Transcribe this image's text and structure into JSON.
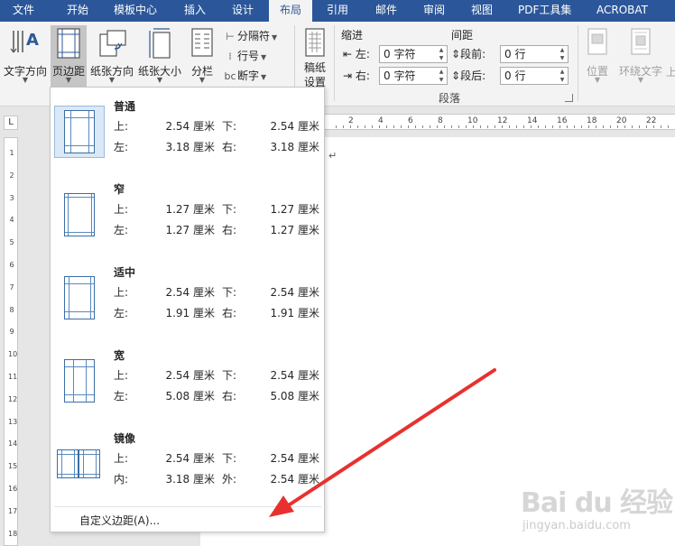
{
  "ribbon_tabs": [
    {
      "label": "文件"
    },
    {
      "label": "开始"
    },
    {
      "label": "模板中心"
    },
    {
      "label": "插入"
    },
    {
      "label": "设计"
    },
    {
      "label": "布局"
    },
    {
      "label": "引用"
    },
    {
      "label": "邮件"
    },
    {
      "label": "审阅"
    },
    {
      "label": "视图"
    },
    {
      "label": "PDF工具集"
    },
    {
      "label": "ACROBAT"
    }
  ],
  "page_setup": {
    "text_direction": "文字方向",
    "margins": "页边距",
    "orientation": "纸张方向",
    "size": "纸张大小",
    "columns": "分栏",
    "breaks": "分隔符",
    "line_numbers": "行号",
    "hyphenation": "断字"
  },
  "manuscript": {
    "label_line1": "稿纸",
    "label_line2": "设置"
  },
  "paragraph": {
    "indent_title": "缩进",
    "spacing_title": "间距",
    "left_label": "左:",
    "left_value": "0 字符",
    "right_label": "右:",
    "right_value": "0 字符",
    "before_label": "段前:",
    "before_value": "0 行",
    "after_label": "段后:",
    "after_value": "0 行",
    "group_label": "段落"
  },
  "arrange": {
    "position": "位置",
    "wrap_text": "环绕文字",
    "bring_forward": "上"
  },
  "rulers": {
    "corner": "L",
    "h_ticks": [
      "2",
      "4",
      "6",
      "8",
      "10",
      "12",
      "14",
      "16",
      "18",
      "20",
      "22"
    ],
    "v_ticks": [
      "1",
      "2",
      "3",
      "4",
      "5",
      "6",
      "7",
      "8",
      "9",
      "10",
      "11",
      "12",
      "13",
      "14",
      "15",
      "16",
      "17",
      "18"
    ]
  },
  "document": {
    "paragraph_mark": "↵"
  },
  "margins_menu": {
    "presets": [
      {
        "name": "普通",
        "label1": "上:",
        "value1": "2.54 厘米",
        "label2": "下:",
        "value2": "2.54 厘米",
        "label3": "左:",
        "value3": "3.18 厘米",
        "label4": "右:",
        "value4": "3.18 厘米"
      },
      {
        "name": "窄",
        "label1": "上:",
        "value1": "1.27 厘米",
        "label2": "下:",
        "value2": "1.27 厘米",
        "label3": "左:",
        "value3": "1.27 厘米",
        "label4": "右:",
        "value4": "1.27 厘米"
      },
      {
        "name": "适中",
        "label1": "上:",
        "value1": "2.54 厘米",
        "label2": "下:",
        "value2": "2.54 厘米",
        "label3": "左:",
        "value3": "1.91 厘米",
        "label4": "右:",
        "value4": "1.91 厘米"
      },
      {
        "name": "宽",
        "label1": "上:",
        "value1": "2.54 厘米",
        "label2": "下:",
        "value2": "2.54 厘米",
        "label3": "左:",
        "value3": "5.08 厘米",
        "label4": "右:",
        "value4": "5.08 厘米"
      },
      {
        "name": "镜像",
        "label1": "上:",
        "value1": "2.54 厘米",
        "label2": "下:",
        "value2": "2.54 厘米",
        "label3": "内:",
        "value3": "3.18 厘米",
        "label4": "外:",
        "value4": "2.54 厘米"
      }
    ],
    "custom": "自定义边距(A)..."
  },
  "watermark": {
    "brand": "Bai du 经验",
    "url": "jingyan.baidu.com"
  },
  "colors": {
    "accent": "#2b579a",
    "arrow": "#e8312f",
    "ribbon_bg": "#f3f3f3"
  }
}
